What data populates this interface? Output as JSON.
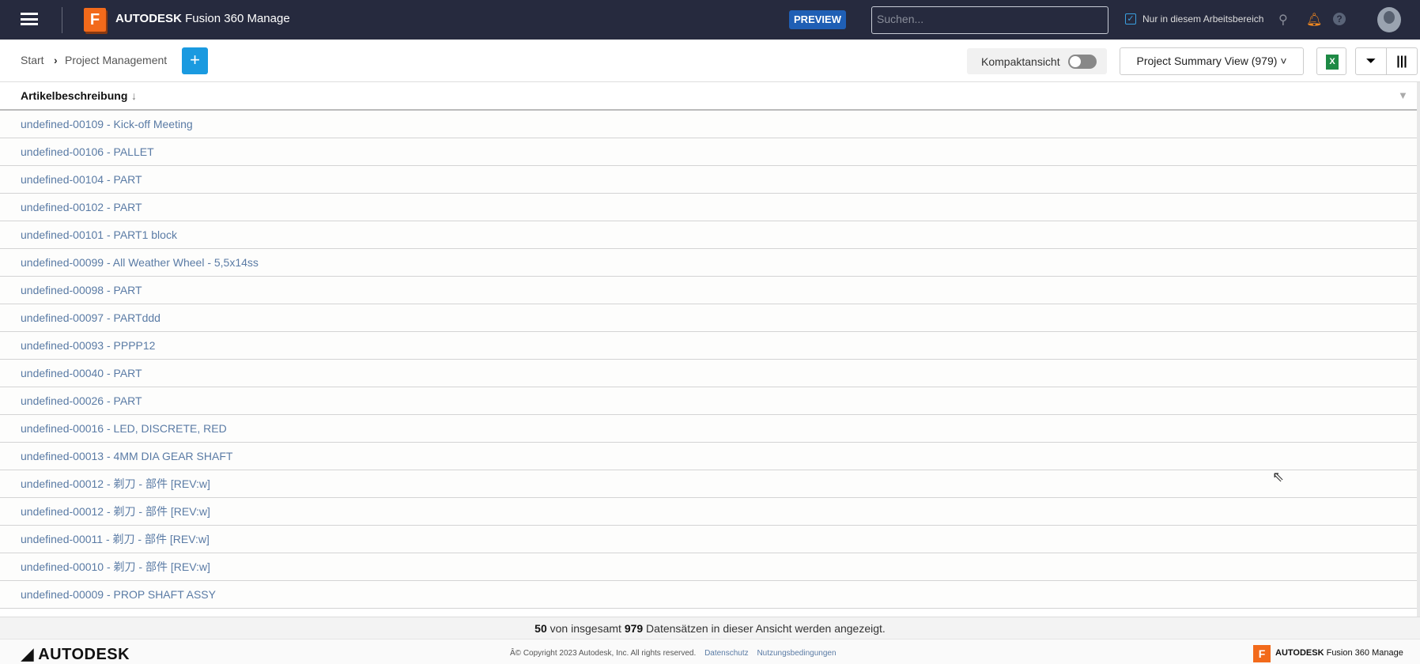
{
  "header": {
    "logo_letter": "F",
    "brand_bold": "AUTODESK",
    "brand_product": "Fusion 360 Manage",
    "preview_badge": "PREVIEW",
    "search_placeholder": "Suchen...",
    "search_scope_label": "Nur in diesem Arbeitsbereich",
    "search_scope_checked": true
  },
  "toolbar": {
    "breadcrumb": [
      "Start",
      "Project Management"
    ],
    "add_label": "+",
    "compact_label": "Kompaktansicht",
    "compact_on": false,
    "view_select": "Project Summary View (979)",
    "export_label": "X"
  },
  "table": {
    "column_header": "Artikelbeschreibung",
    "sort_indicator": "↓",
    "rows": [
      "undefined-00109 - Kick-off Meeting",
      "undefined-00106 - PALLET",
      "undefined-00104 - PART",
      "undefined-00102 - PART",
      "undefined-00101 - PART1 block",
      "undefined-00099 - All Weather Wheel - 5,5x14ss",
      "undefined-00098 - PART",
      "undefined-00097 - PARTddd",
      "undefined-00093 - PPPP12",
      "undefined-00040 - PART",
      "undefined-00026 - PART",
      "undefined-00016 - LED, DISCRETE, RED",
      "undefined-00013 - 4MM DIA GEAR SHAFT",
      "undefined-00012 - 剃刀 - 部件 [REV:w]",
      "undefined-00012 - 剃刀 - 部件 [REV:w]",
      "undefined-00011 - 剃刀 - 部件 [REV:w]",
      "undefined-00010 - 剃刀 - 部件 [REV:w]",
      "undefined-00009 - PROP SHAFT ASSY"
    ]
  },
  "status": {
    "shown": "50",
    "text_mid": " von insgesamt ",
    "total": "979",
    "text_end": " Datensätzen in dieser Ansicht werden angezeigt."
  },
  "footer": {
    "logo": "AUTODESK",
    "copyright": "Â© Copyright 2023 Autodesk, Inc. All rights reserved.",
    "privacy_link": "Datenschutz",
    "terms_link": "Nutzungsbedingungen",
    "brand_bold": "AUTODESK",
    "brand_product": "Fusion 360 Manage"
  },
  "colors": {
    "topbar": "#262a3e",
    "accent": "#1a9ae0",
    "link": "#5a7ba5",
    "logo": "#f26a1b"
  }
}
